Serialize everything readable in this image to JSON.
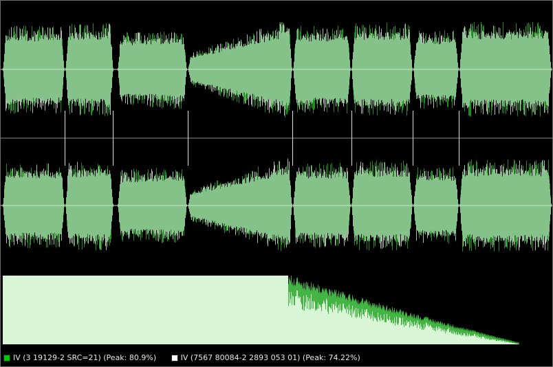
{
  "view": {
    "type": "audio-waveform-comparison",
    "channel_count": 2,
    "bottom_panel": "peak-spectrum"
  },
  "colors": {
    "background": "#000000",
    "track_a": "#00c800",
    "track_b": "#ffffff",
    "waveform_fill": "#85c28a",
    "spectrum_fill": "#d8f5d6"
  },
  "legend": {
    "items": [
      {
        "swatch_color": "#00c800",
        "label": "IV (3 19129-2 SRC=21) (Peak: 80.9%)"
      },
      {
        "swatch_color": "#ffffff",
        "label": "IV (7567 80084-2 2893 053 01) (Peak: 74.22%)"
      }
    ]
  }
}
